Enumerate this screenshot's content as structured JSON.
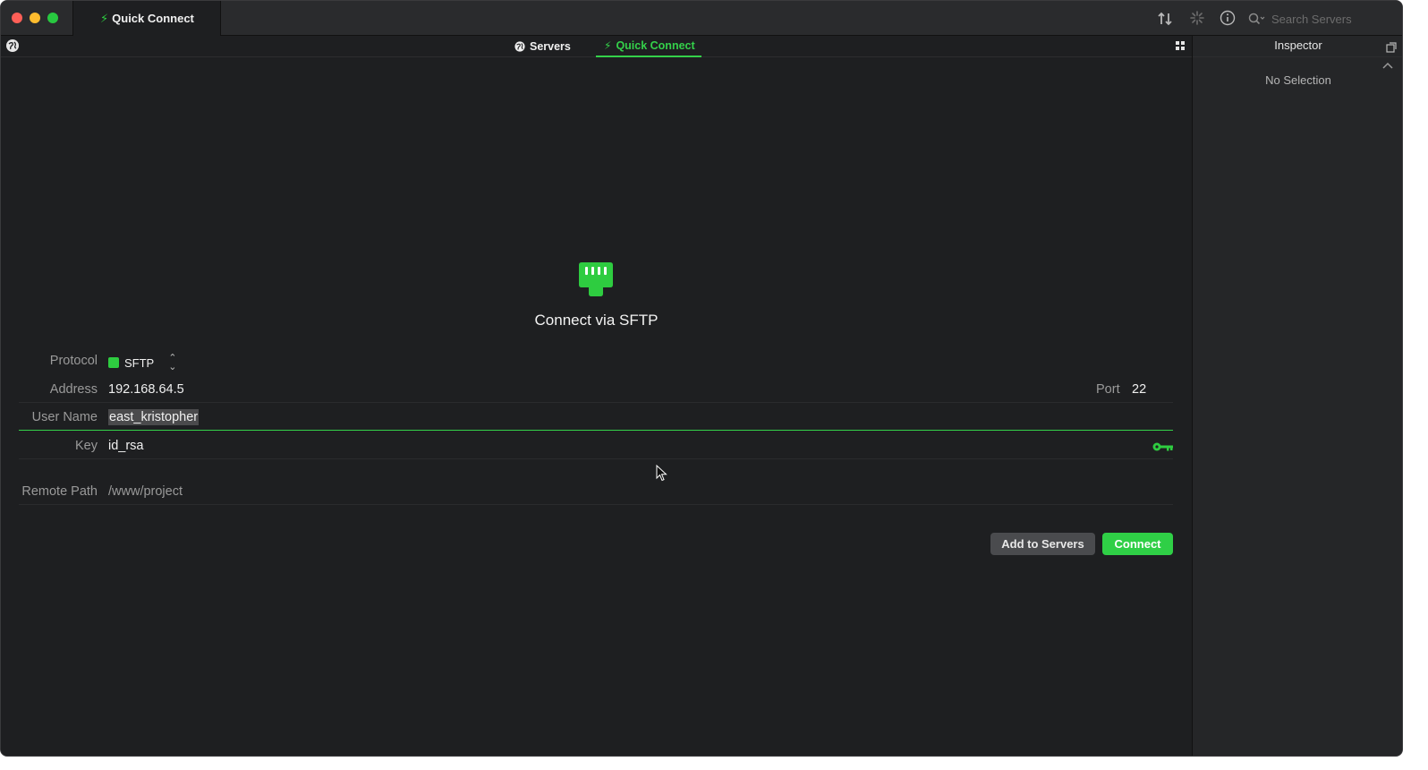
{
  "titlebar": {
    "tab_label": "Quick Connect",
    "search_placeholder": "Search Servers",
    "icons": [
      "transfer-icon",
      "activity-icon",
      "info-icon",
      "search-icon"
    ]
  },
  "tabs": [
    {
      "label": "Servers",
      "icon": "globe-icon",
      "active": false
    },
    {
      "label": "Quick Connect",
      "icon": "bolt-icon",
      "active": true
    }
  ],
  "hero": {
    "icon": "sftp-port-icon",
    "title": "Connect via SFTP"
  },
  "form": {
    "protocol": {
      "label": "Protocol",
      "value": "SFTP"
    },
    "address": {
      "label": "Address",
      "value": "192.168.64.5"
    },
    "port": {
      "label": "Port",
      "value": "22"
    },
    "username": {
      "label": "User Name",
      "value": "east_kristopher"
    },
    "key": {
      "label": "Key",
      "value": "id_rsa",
      "icon": "key-icon"
    },
    "remote_path": {
      "label": "Remote Path",
      "value": "/www/project"
    }
  },
  "buttons": {
    "add_to_servers": "Add to Servers",
    "connect": "Connect"
  },
  "inspector": {
    "title": "Inspector",
    "empty": "No Selection"
  },
  "colors": {
    "accent": "#34d14a",
    "background": "#1e1f21",
    "inspector_bg": "#252628"
  }
}
